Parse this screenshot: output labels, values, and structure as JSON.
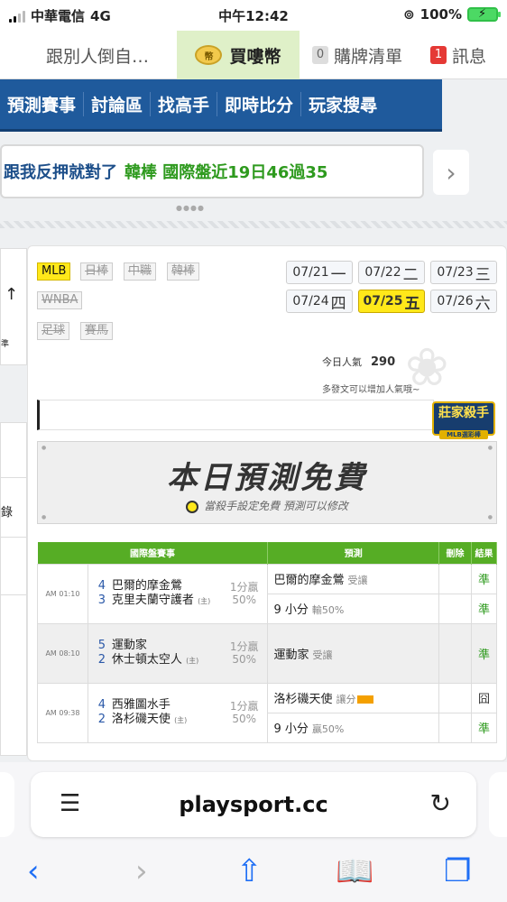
{
  "status_bar": {
    "carrier": "中華電信",
    "network": "4G",
    "time": "中午12:42",
    "battery": "100%"
  },
  "top_tabs": [
    {
      "label": "跟別人倒自…"
    },
    {
      "label": "買嘍幣",
      "icon": "coin-icon"
    },
    {
      "label": "購牌清單",
      "count": "0"
    },
    {
      "label": "訊息",
      "count": "1"
    }
  ],
  "nav": [
    "預測賽事",
    "討論區",
    "找高手",
    "即時比分",
    "玩家搜尋"
  ],
  "promo": {
    "text": "跟我反押就對了",
    "highlight": "韓棒 國際盤近19日46過35"
  },
  "sports": [
    "MLB",
    "日棒",
    "中職",
    "韓棒",
    "WNBA",
    "足球",
    "賽馬"
  ],
  "dates": [
    {
      "md": "07/21",
      "day": "一"
    },
    {
      "md": "07/22",
      "day": "二"
    },
    {
      "md": "07/23",
      "day": "三"
    },
    {
      "md": "07/24",
      "day": "四"
    },
    {
      "md": "07/25",
      "day": "五"
    },
    {
      "md": "07/26",
      "day": "六"
    }
  ],
  "selected_date_index": 4,
  "popularity": {
    "label": "今日人氣",
    "value": "290",
    "hint": "多發文可以增加人氣哦~"
  },
  "killer_badge": {
    "title": "莊家殺手",
    "sub": "MLB選彩棒"
  },
  "banner": {
    "title": "本日預測免費",
    "sub": "當殺手設定免費 預測可以修改"
  },
  "table": {
    "headers": [
      "國際盤賽事",
      "預測",
      "刪除",
      "結果"
    ],
    "games": [
      {
        "time": "AM 01:10",
        "away_num": "4",
        "away": "巴爾的摩金鶯",
        "home_num": "3",
        "home": "克里夫蘭守護者",
        "home_mark": "(主)",
        "odds_line1": "1分贏",
        "odds_line2": "50%",
        "picks": [
          {
            "text": "巴爾的摩金鶯",
            "tag": "受讓",
            "result": "準"
          },
          {
            "text": "9 小分",
            "tag": "輸50%",
            "result": "準"
          }
        ]
      },
      {
        "time": "AM 08:10",
        "away_num": "5",
        "away": "運動家",
        "home_num": "2",
        "home": "休士頓太空人",
        "home_mark": "(主)",
        "odds_line1": "1分贏",
        "odds_line2": "50%",
        "picks": [
          {
            "text": "運動家",
            "tag": "受讓",
            "result": "準"
          }
        ]
      },
      {
        "time": "AM 09:38",
        "away_num": "4",
        "away": "西雅圖水手",
        "home_num": "2",
        "home": "洛杉磯天使",
        "home_mark": "(主)",
        "odds_line1": "1分贏",
        "odds_line2": "50%",
        "picks": [
          {
            "text": "洛杉磯天使",
            "tag": "讓分",
            "result": "囧"
          },
          {
            "text": "9 小分",
            "tag": "贏50%",
            "result": "準"
          }
        ]
      }
    ]
  },
  "url_bar": {
    "host": "playsport.cc"
  },
  "colors": {
    "nav_blue": "#1f5a9c",
    "table_green": "#56ad25",
    "active_yellow": "#ffe81a",
    "safari_blue": "#1f6ff5"
  }
}
